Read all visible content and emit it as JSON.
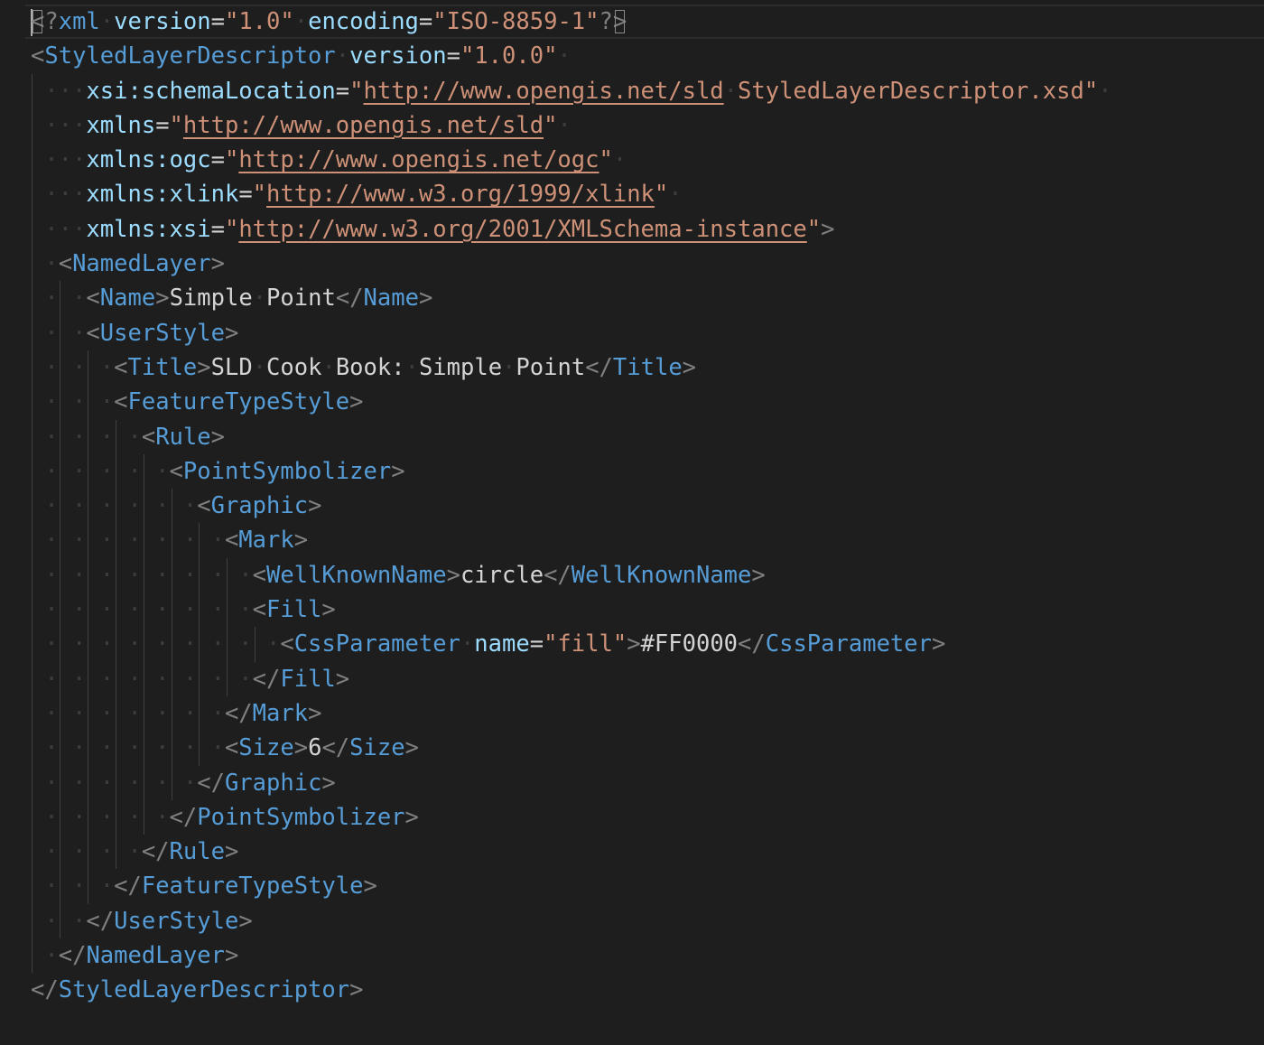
{
  "editor": {
    "language": "xml",
    "colors": {
      "background": "#1e1e1e",
      "punctuation": "#808080",
      "tag": "#569cd6",
      "attribute": "#9cdcfe",
      "string": "#ce9178",
      "text": "#d4d4d4",
      "whitespace_dot": "#3d3d3d",
      "indent_guide": "#404040"
    },
    "lines": [
      {
        "indent": 0,
        "guides": [],
        "tokens": [
          {
            "t": "punct",
            "v": "<",
            "box": true,
            "cursor": true
          },
          {
            "t": "punct",
            "v": "?"
          },
          {
            "t": "tag",
            "v": "xml"
          },
          {
            "t": "ws",
            "v": "·"
          },
          {
            "t": "attr",
            "v": "version"
          },
          {
            "t": "text",
            "v": "="
          },
          {
            "t": "str",
            "v": "\"1.0\""
          },
          {
            "t": "ws",
            "v": "·"
          },
          {
            "t": "attr",
            "v": "encoding"
          },
          {
            "t": "text",
            "v": "="
          },
          {
            "t": "str",
            "v": "\"ISO-8859-1\""
          },
          {
            "t": "punct",
            "v": "?"
          },
          {
            "t": "punct",
            "v": ">",
            "box": true
          }
        ]
      },
      {
        "indent": 0,
        "guides": [],
        "tokens": [
          {
            "t": "punct",
            "v": "<"
          },
          {
            "t": "tag",
            "v": "StyledLayerDescriptor"
          },
          {
            "t": "ws",
            "v": "·"
          },
          {
            "t": "attr",
            "v": "version"
          },
          {
            "t": "text",
            "v": "="
          },
          {
            "t": "str",
            "v": "\"1.0.0\""
          },
          {
            "t": "ws",
            "v": "·"
          }
        ]
      },
      {
        "indent": 4,
        "guides": [
          0
        ],
        "tokens": [
          {
            "t": "attr",
            "v": "xsi:schemaLocation"
          },
          {
            "t": "text",
            "v": "="
          },
          {
            "t": "str",
            "v": "\""
          },
          {
            "t": "str",
            "v": "http://www.opengis.net/sld",
            "url": true
          },
          {
            "t": "ws",
            "v": "·"
          },
          {
            "t": "str",
            "v": "StyledLayerDescriptor.xsd\""
          },
          {
            "t": "ws",
            "v": "·"
          }
        ]
      },
      {
        "indent": 4,
        "guides": [
          0
        ],
        "tokens": [
          {
            "t": "attr",
            "v": "xmlns"
          },
          {
            "t": "text",
            "v": "="
          },
          {
            "t": "str",
            "v": "\""
          },
          {
            "t": "str",
            "v": "http://www.opengis.net/sld",
            "url": true
          },
          {
            "t": "str",
            "v": "\""
          },
          {
            "t": "ws",
            "v": "·"
          }
        ]
      },
      {
        "indent": 4,
        "guides": [
          0
        ],
        "tokens": [
          {
            "t": "attr",
            "v": "xmlns:ogc"
          },
          {
            "t": "text",
            "v": "="
          },
          {
            "t": "str",
            "v": "\""
          },
          {
            "t": "str",
            "v": "http://www.opengis.net/ogc",
            "url": true
          },
          {
            "t": "str",
            "v": "\""
          },
          {
            "t": "ws",
            "v": "·"
          }
        ]
      },
      {
        "indent": 4,
        "guides": [
          0
        ],
        "tokens": [
          {
            "t": "attr",
            "v": "xmlns:xlink"
          },
          {
            "t": "text",
            "v": "="
          },
          {
            "t": "str",
            "v": "\""
          },
          {
            "t": "str",
            "v": "http://www.w3.org/1999/xlink",
            "url": true
          },
          {
            "t": "str",
            "v": "\""
          },
          {
            "t": "ws",
            "v": "·"
          }
        ]
      },
      {
        "indent": 4,
        "guides": [
          0
        ],
        "tokens": [
          {
            "t": "attr",
            "v": "xmlns:xsi"
          },
          {
            "t": "text",
            "v": "="
          },
          {
            "t": "str",
            "v": "\""
          },
          {
            "t": "str",
            "v": "http://www.w3.org/2001/XMLSchema-instance",
            "url": true
          },
          {
            "t": "str",
            "v": "\""
          },
          {
            "t": "punct",
            "v": ">"
          }
        ]
      },
      {
        "indent": 2,
        "guides": [
          0
        ],
        "tokens": [
          {
            "t": "punct",
            "v": "<"
          },
          {
            "t": "tag",
            "v": "NamedLayer"
          },
          {
            "t": "punct",
            "v": ">"
          }
        ]
      },
      {
        "indent": 4,
        "guides": [
          0,
          2
        ],
        "tokens": [
          {
            "t": "punct",
            "v": "<"
          },
          {
            "t": "tag",
            "v": "Name"
          },
          {
            "t": "punct",
            "v": ">"
          },
          {
            "t": "text",
            "v": "Simple"
          },
          {
            "t": "ws",
            "v": "·"
          },
          {
            "t": "text",
            "v": "Point"
          },
          {
            "t": "punct",
            "v": "</"
          },
          {
            "t": "tag",
            "v": "Name"
          },
          {
            "t": "punct",
            "v": ">"
          }
        ]
      },
      {
        "indent": 4,
        "guides": [
          0,
          2
        ],
        "tokens": [
          {
            "t": "punct",
            "v": "<"
          },
          {
            "t": "tag",
            "v": "UserStyle"
          },
          {
            "t": "punct",
            "v": ">"
          }
        ]
      },
      {
        "indent": 6,
        "guides": [
          0,
          2,
          4
        ],
        "tokens": [
          {
            "t": "punct",
            "v": "<"
          },
          {
            "t": "tag",
            "v": "Title"
          },
          {
            "t": "punct",
            "v": ">"
          },
          {
            "t": "text",
            "v": "SLD"
          },
          {
            "t": "ws",
            "v": "·"
          },
          {
            "t": "text",
            "v": "Cook"
          },
          {
            "t": "ws",
            "v": "·"
          },
          {
            "t": "text",
            "v": "Book:"
          },
          {
            "t": "ws",
            "v": "·"
          },
          {
            "t": "text",
            "v": "Simple"
          },
          {
            "t": "ws",
            "v": "·"
          },
          {
            "t": "text",
            "v": "Point"
          },
          {
            "t": "punct",
            "v": "</"
          },
          {
            "t": "tag",
            "v": "Title"
          },
          {
            "t": "punct",
            "v": ">"
          }
        ]
      },
      {
        "indent": 6,
        "guides": [
          0,
          2,
          4
        ],
        "tokens": [
          {
            "t": "punct",
            "v": "<"
          },
          {
            "t": "tag",
            "v": "FeatureTypeStyle"
          },
          {
            "t": "punct",
            "v": ">"
          }
        ]
      },
      {
        "indent": 8,
        "guides": [
          0,
          2,
          4,
          6
        ],
        "tokens": [
          {
            "t": "punct",
            "v": "<"
          },
          {
            "t": "tag",
            "v": "Rule"
          },
          {
            "t": "punct",
            "v": ">"
          }
        ]
      },
      {
        "indent": 10,
        "guides": [
          0,
          2,
          4,
          6,
          8
        ],
        "tokens": [
          {
            "t": "punct",
            "v": "<"
          },
          {
            "t": "tag",
            "v": "PointSymbolizer"
          },
          {
            "t": "punct",
            "v": ">"
          }
        ]
      },
      {
        "indent": 12,
        "guides": [
          0,
          2,
          4,
          6,
          8,
          10
        ],
        "tokens": [
          {
            "t": "punct",
            "v": "<"
          },
          {
            "t": "tag",
            "v": "Graphic"
          },
          {
            "t": "punct",
            "v": ">"
          }
        ]
      },
      {
        "indent": 14,
        "guides": [
          0,
          2,
          4,
          6,
          8,
          10,
          12
        ],
        "tokens": [
          {
            "t": "punct",
            "v": "<"
          },
          {
            "t": "tag",
            "v": "Mark"
          },
          {
            "t": "punct",
            "v": ">"
          }
        ]
      },
      {
        "indent": 16,
        "guides": [
          0,
          2,
          4,
          6,
          8,
          10,
          12,
          14
        ],
        "tokens": [
          {
            "t": "punct",
            "v": "<"
          },
          {
            "t": "tag",
            "v": "WellKnownName"
          },
          {
            "t": "punct",
            "v": ">"
          },
          {
            "t": "text",
            "v": "circle"
          },
          {
            "t": "punct",
            "v": "</"
          },
          {
            "t": "tag",
            "v": "WellKnownName"
          },
          {
            "t": "punct",
            "v": ">"
          }
        ]
      },
      {
        "indent": 16,
        "guides": [
          0,
          2,
          4,
          6,
          8,
          10,
          12,
          14
        ],
        "tokens": [
          {
            "t": "punct",
            "v": "<"
          },
          {
            "t": "tag",
            "v": "Fill"
          },
          {
            "t": "punct",
            "v": ">"
          }
        ]
      },
      {
        "indent": 18,
        "guides": [
          0,
          2,
          4,
          6,
          8,
          10,
          12,
          14,
          16
        ],
        "tokens": [
          {
            "t": "punct",
            "v": "<"
          },
          {
            "t": "tag",
            "v": "CssParameter"
          },
          {
            "t": "ws",
            "v": "·"
          },
          {
            "t": "attr",
            "v": "name"
          },
          {
            "t": "text",
            "v": "="
          },
          {
            "t": "str",
            "v": "\"fill\""
          },
          {
            "t": "punct",
            "v": ">"
          },
          {
            "t": "text",
            "v": "#FF0000"
          },
          {
            "t": "punct",
            "v": "</"
          },
          {
            "t": "tag",
            "v": "CssParameter"
          },
          {
            "t": "punct",
            "v": ">"
          }
        ]
      },
      {
        "indent": 16,
        "guides": [
          0,
          2,
          4,
          6,
          8,
          10,
          12,
          14
        ],
        "tokens": [
          {
            "t": "punct",
            "v": "</"
          },
          {
            "t": "tag",
            "v": "Fill"
          },
          {
            "t": "punct",
            "v": ">"
          }
        ]
      },
      {
        "indent": 14,
        "guides": [
          0,
          2,
          4,
          6,
          8,
          10,
          12
        ],
        "tokens": [
          {
            "t": "punct",
            "v": "</"
          },
          {
            "t": "tag",
            "v": "Mark"
          },
          {
            "t": "punct",
            "v": ">"
          }
        ]
      },
      {
        "indent": 14,
        "guides": [
          0,
          2,
          4,
          6,
          8,
          10,
          12
        ],
        "tokens": [
          {
            "t": "punct",
            "v": "<"
          },
          {
            "t": "tag",
            "v": "Size"
          },
          {
            "t": "punct",
            "v": ">"
          },
          {
            "t": "text",
            "v": "6"
          },
          {
            "t": "punct",
            "v": "</"
          },
          {
            "t": "tag",
            "v": "Size"
          },
          {
            "t": "punct",
            "v": ">"
          }
        ]
      },
      {
        "indent": 12,
        "guides": [
          0,
          2,
          4,
          6,
          8,
          10
        ],
        "tokens": [
          {
            "t": "punct",
            "v": "</"
          },
          {
            "t": "tag",
            "v": "Graphic"
          },
          {
            "t": "punct",
            "v": ">"
          }
        ]
      },
      {
        "indent": 10,
        "guides": [
          0,
          2,
          4,
          6,
          8
        ],
        "tokens": [
          {
            "t": "punct",
            "v": "</"
          },
          {
            "t": "tag",
            "v": "PointSymbolizer"
          },
          {
            "t": "punct",
            "v": ">"
          }
        ]
      },
      {
        "indent": 8,
        "guides": [
          0,
          2,
          4,
          6
        ],
        "tokens": [
          {
            "t": "punct",
            "v": "</"
          },
          {
            "t": "tag",
            "v": "Rule"
          },
          {
            "t": "punct",
            "v": ">"
          }
        ]
      },
      {
        "indent": 6,
        "guides": [
          0,
          2,
          4
        ],
        "tokens": [
          {
            "t": "punct",
            "v": "</"
          },
          {
            "t": "tag",
            "v": "FeatureTypeStyle"
          },
          {
            "t": "punct",
            "v": ">"
          }
        ]
      },
      {
        "indent": 4,
        "guides": [
          0,
          2
        ],
        "tokens": [
          {
            "t": "punct",
            "v": "</"
          },
          {
            "t": "tag",
            "v": "UserStyle"
          },
          {
            "t": "punct",
            "v": ">"
          }
        ]
      },
      {
        "indent": 2,
        "guides": [
          0
        ],
        "tokens": [
          {
            "t": "punct",
            "v": "</"
          },
          {
            "t": "tag",
            "v": "NamedLayer"
          },
          {
            "t": "punct",
            "v": ">"
          }
        ]
      },
      {
        "indent": 0,
        "guides": [],
        "tokens": [
          {
            "t": "punct",
            "v": "</"
          },
          {
            "t": "tag",
            "v": "StyledLayerDescriptor"
          },
          {
            "t": "punct",
            "v": ">"
          }
        ]
      }
    ]
  }
}
